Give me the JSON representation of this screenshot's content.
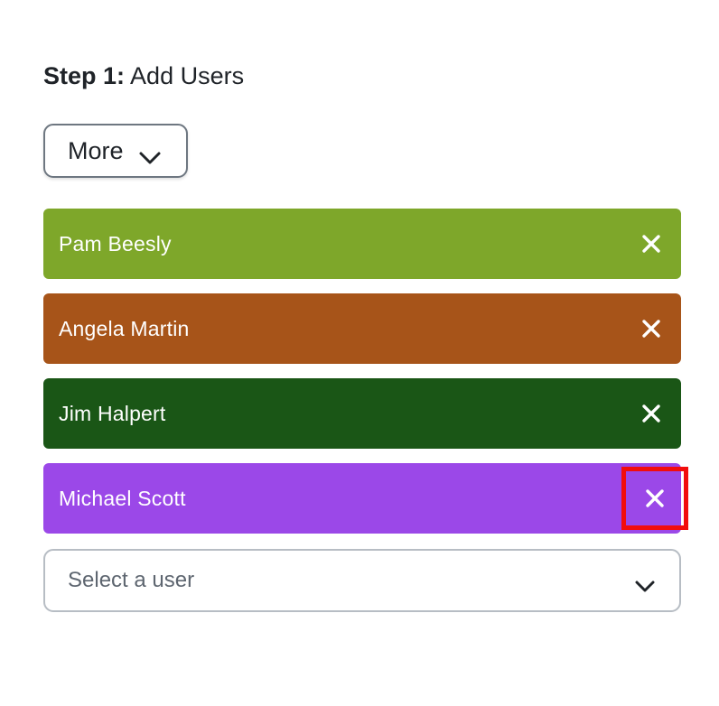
{
  "step": {
    "strong": "Step 1:",
    "text": "Add Users"
  },
  "more_button": {
    "label": "More",
    "icon": "chevron-down-icon"
  },
  "users": [
    {
      "name": "Pam Beesly",
      "color": "#7ea72a"
    },
    {
      "name": "Angela Martin",
      "color": "#a75419"
    },
    {
      "name": "Jim Halpert",
      "color": "#1a5616"
    },
    {
      "name": "Michael Scott",
      "color": "#9b48e8"
    }
  ],
  "remove_icon": "close-icon",
  "highlight_color": "#f20d0d",
  "user_select": {
    "placeholder": "Select a user",
    "icon": "chevron-down-icon"
  }
}
